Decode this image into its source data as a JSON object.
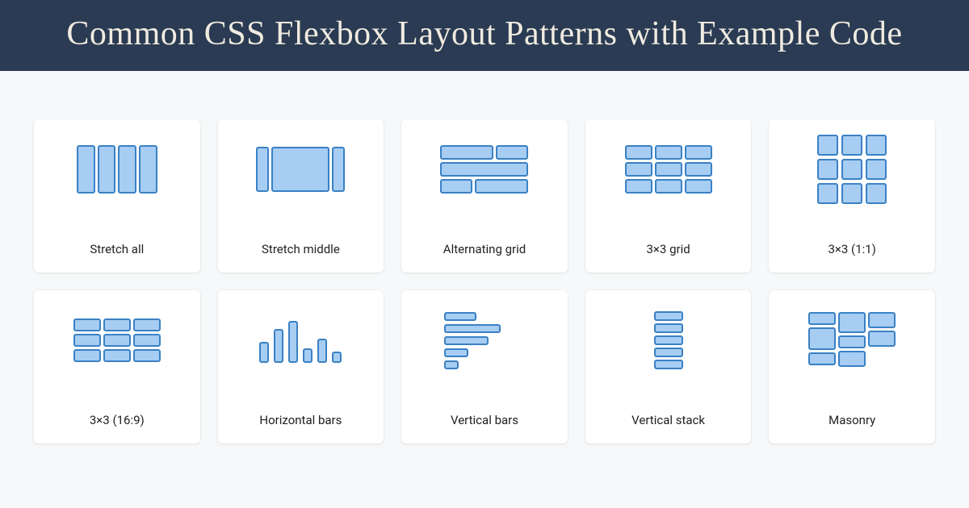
{
  "title": "Common CSS Flexbox Layout Patterns with Example Code",
  "cards": [
    {
      "label": "Stretch all"
    },
    {
      "label": "Stretch middle"
    },
    {
      "label": "Alternating grid"
    },
    {
      "label": "3×3 grid"
    },
    {
      "label": "3×3 (1:1)"
    },
    {
      "label": "3×3 (16:9)"
    },
    {
      "label": "Horizontal bars"
    },
    {
      "label": "Vertical bars"
    },
    {
      "label": "Vertical stack"
    },
    {
      "label": "Masonry"
    }
  ],
  "colors": {
    "header_bg": "#2a3b53",
    "box_fill": "#a7cdf2",
    "box_stroke": "#3a81c4"
  }
}
